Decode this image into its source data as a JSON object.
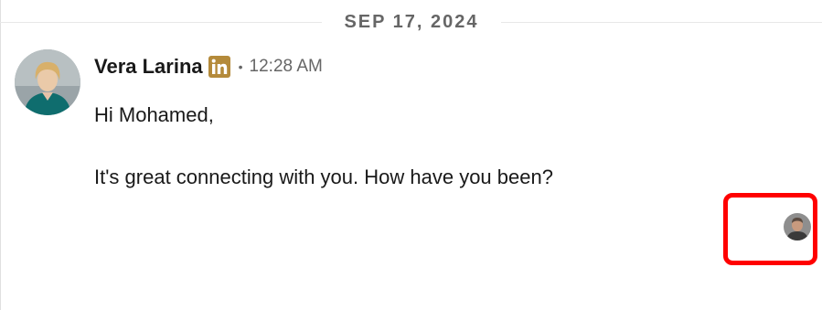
{
  "date_divider": {
    "label": "SEP 17, 2024"
  },
  "message": {
    "sender_name": "Vera Larina",
    "sender_badge_icon": "linkedin-in-icon",
    "separator": "•",
    "timestamp": "12:28 AM",
    "body_lines": [
      "Hi Mohamed,",
      "It's great connecting with you. How have you been?"
    ]
  },
  "read_receipt": {
    "icon": "viewer-avatar-icon",
    "highlight_color": "#ff0000"
  },
  "colors": {
    "badge_gold": "#b48a3a",
    "muted_text": "#666666",
    "primary_text": "#191919"
  }
}
